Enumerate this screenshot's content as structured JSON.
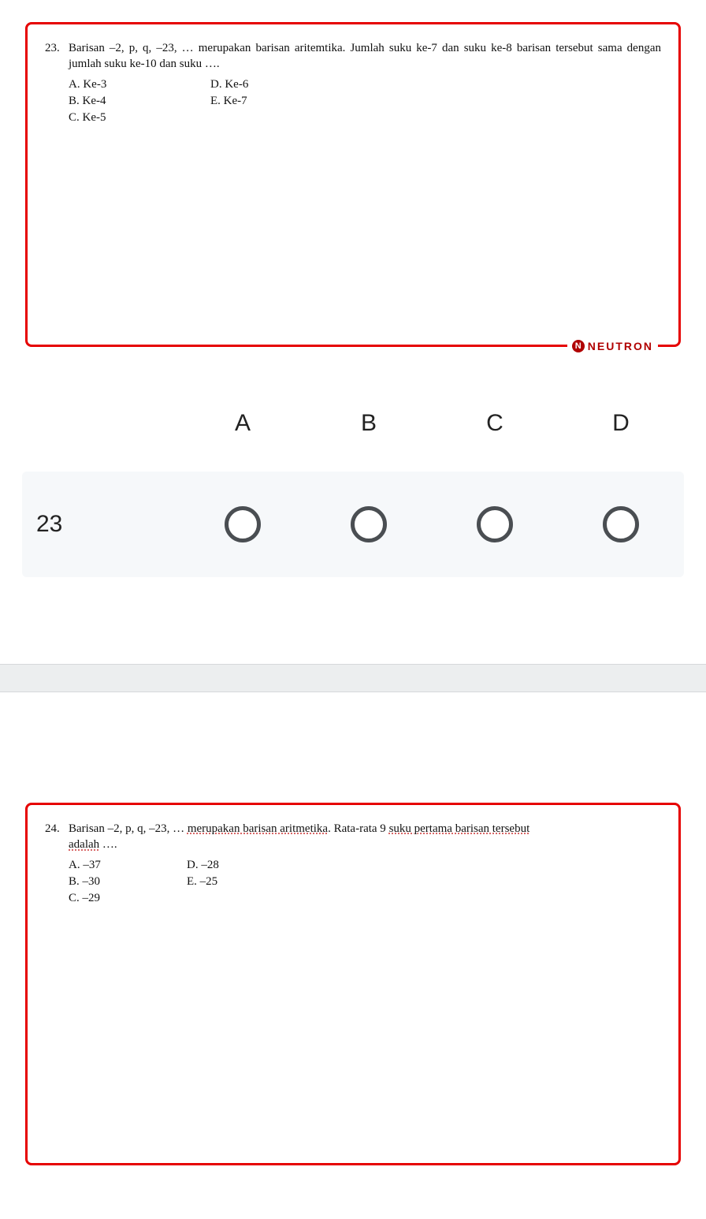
{
  "brand": {
    "icon_letter": "N",
    "text": "NEUTRON"
  },
  "q23": {
    "number": "23.",
    "text": "Barisan –2, p, q, –23, … merupakan barisan aritemtika. Jumlah suku ke-7 dan suku ke-8 barisan tersebut sama dengan jumlah suku ke-10 dan suku ….",
    "opts": {
      "A": "A.  Ke-3",
      "B": "B.  Ke-4",
      "C": "C.  Ke-5",
      "D": "D. Ke-6",
      "E": "E. Ke-7"
    }
  },
  "answer_table": {
    "headers": [
      "A",
      "B",
      "C",
      "D"
    ],
    "row_label": "23"
  },
  "q24": {
    "number": "24.",
    "text_plain": "Barisan –2, p, q, –23, … ",
    "text_u1": "merupakan barisan aritmetika",
    "text_mid": ". Rata-rata 9 ",
    "text_u2": "suku pertama barisan tersebut",
    "text_tail": " ",
    "adalah": "adalah",
    "dots": " ….",
    "opts": {
      "A": "A.  –37",
      "B": "B.  –30",
      "C": "C.  –29",
      "D": "D. –28",
      "E": "E. –25"
    }
  }
}
